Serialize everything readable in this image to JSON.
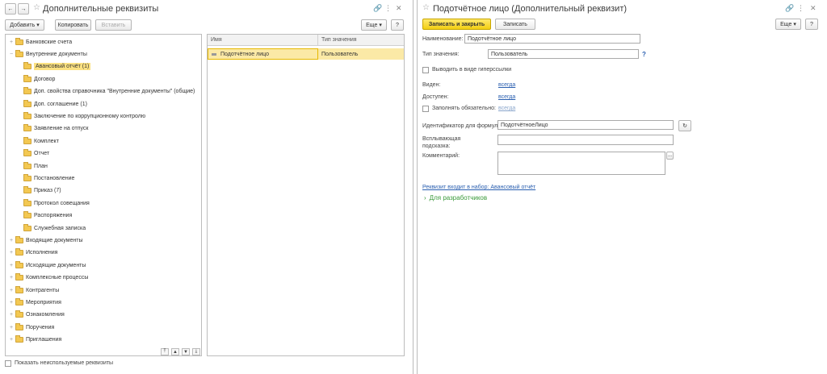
{
  "left": {
    "title": "Дополнительные реквизиты",
    "toolbar": {
      "add": "Добавить",
      "copy": "Копировать",
      "paste": "Вставить",
      "more": "Еще",
      "help": "?"
    },
    "tree": [
      {
        "label": "Банковские счета",
        "level": 0,
        "expander": "+"
      },
      {
        "label": "Внутренние документы",
        "level": 0,
        "expander": "−"
      },
      {
        "label": "Авансовый отчёт (1)",
        "level": 1,
        "selected": true
      },
      {
        "label": "Договор",
        "level": 1
      },
      {
        "label": "Доп. свойства справочника \"Внутренние документы\" (общие)",
        "level": 1
      },
      {
        "label": "Доп. соглашение (1)",
        "level": 1
      },
      {
        "label": "Заключение по коррупционному контролю",
        "level": 1
      },
      {
        "label": "Заявление на отпуск",
        "level": 1
      },
      {
        "label": "Комплект",
        "level": 1
      },
      {
        "label": "Отчет",
        "level": 1
      },
      {
        "label": "План",
        "level": 1
      },
      {
        "label": "Постановление",
        "level": 1
      },
      {
        "label": "Приказ (7)",
        "level": 1
      },
      {
        "label": "Протокол совещания",
        "level": 1
      },
      {
        "label": "Распоряжения",
        "level": 1
      },
      {
        "label": "Служебная записка",
        "level": 1
      },
      {
        "label": "Входящие документы",
        "level": 0,
        "expander": "+"
      },
      {
        "label": "Исполнения",
        "level": 0,
        "expander": "+"
      },
      {
        "label": "Исходящие документы",
        "level": 0,
        "expander": "+"
      },
      {
        "label": "Комплексные процессы",
        "level": 0,
        "expander": "+"
      },
      {
        "label": "Контрагенты",
        "level": 0,
        "expander": "+"
      },
      {
        "label": "Мероприятия",
        "level": 0,
        "expander": "+"
      },
      {
        "label": "Ознакомления",
        "level": 0,
        "expander": "+"
      },
      {
        "label": "Поручения",
        "level": 0,
        "expander": "+"
      },
      {
        "label": "Приглашения",
        "level": 0,
        "expander": "+"
      }
    ],
    "table": {
      "headers": [
        "Имя",
        "Тип значения"
      ],
      "rows": [
        [
          "Подотчётное лицо",
          "Пользователь"
        ]
      ]
    },
    "show_unused": "Показать неиспользуемые реквизиты"
  },
  "right": {
    "title": "Подотчётное лицо (Дополнительный реквизит)",
    "toolbar": {
      "save_close": "Записать и закрыть",
      "save": "Записать",
      "more": "Еще",
      "help": "?"
    },
    "name_label": "Наименование:",
    "name_value": "Подотчётное лицо",
    "type_label": "Тип значения:",
    "type_value": "Пользователь",
    "type_help": "?",
    "hyperlink_label": "Выводить в виде гиперссылки",
    "visible_label": "Виден:",
    "visible_value": "всегда",
    "available_label": "Доступен:",
    "available_value": "всегда",
    "required_label": "Заполнять обязательно:",
    "required_value": "всегда",
    "formula_id_label": "Идентификатор для формул:",
    "formula_id_value": "ПодотчётноеЛицо",
    "tooltip_label": "Всплывающая подсказка:",
    "comment_label": "Комментарий:",
    "comment_btn": "...",
    "set_link": "Реквизит входит в набор: Авансовый отчёт",
    "dev_section": "Для разработчиков"
  }
}
